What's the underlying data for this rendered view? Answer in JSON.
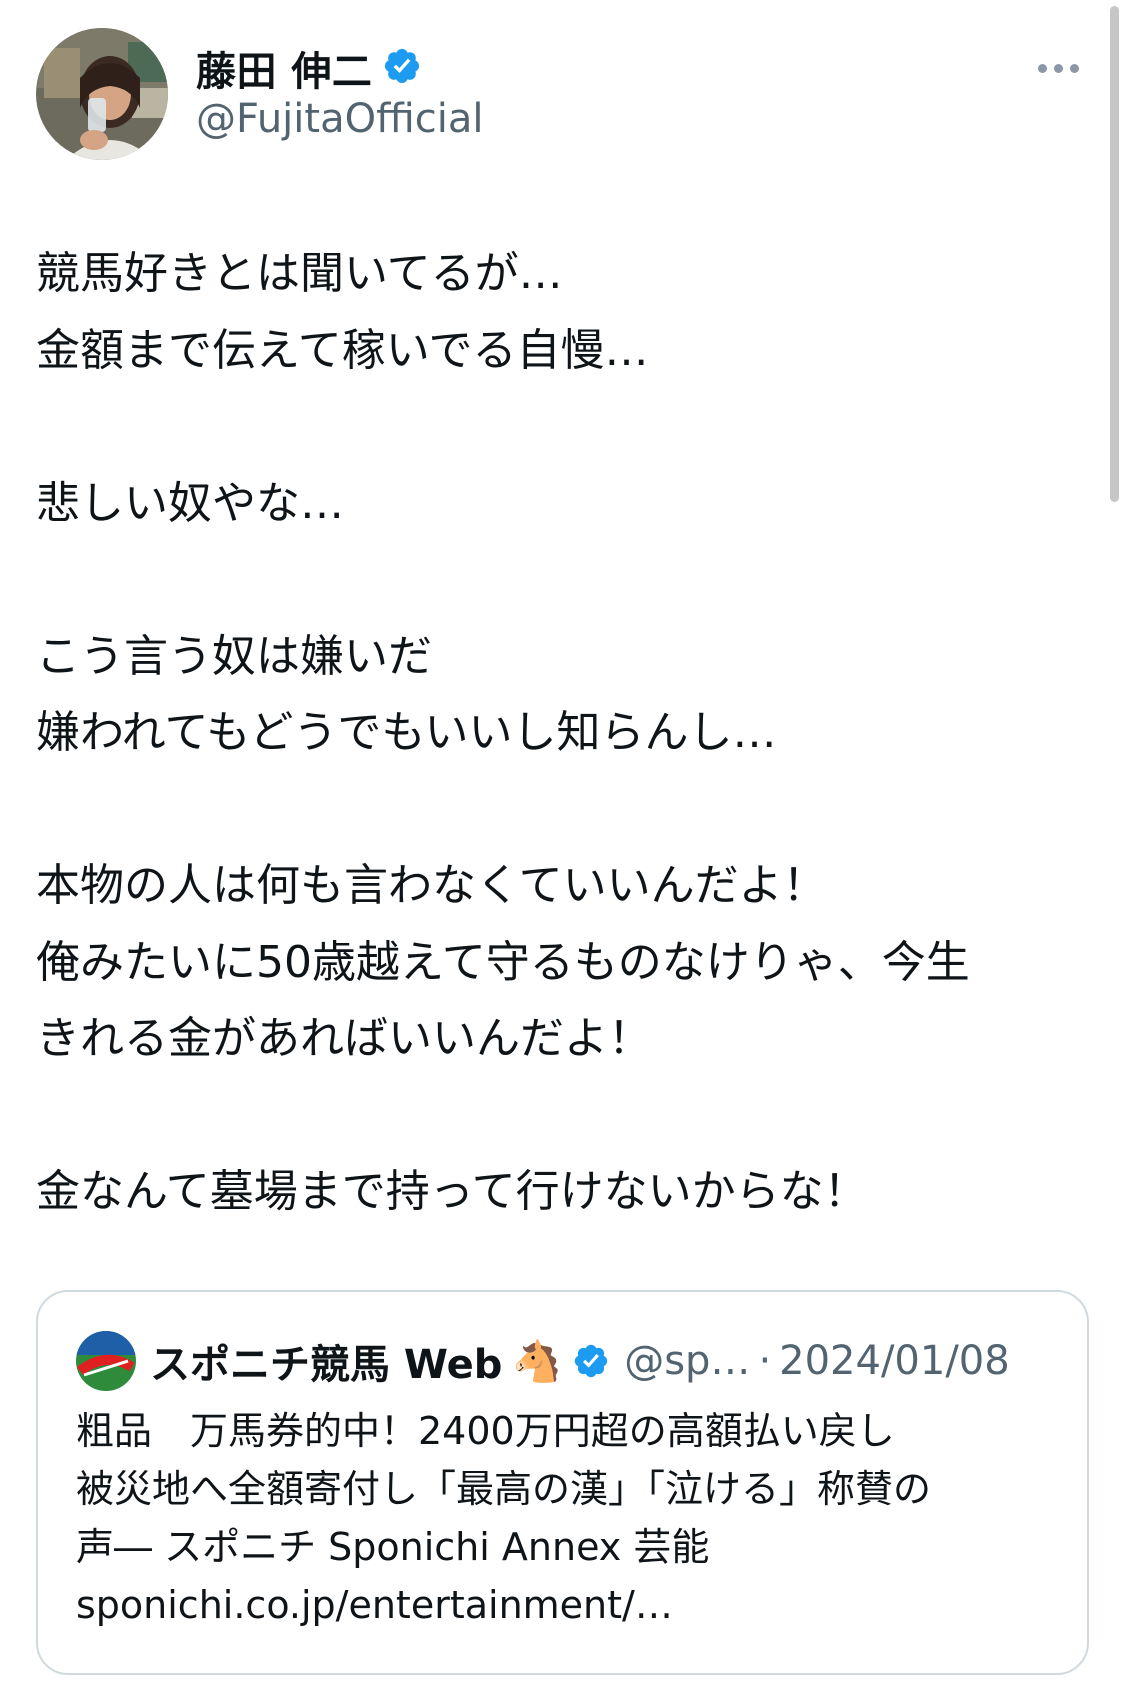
{
  "author": {
    "name": "藤田 伸二",
    "handle": "@FujitaOfficial",
    "verified": true,
    "badge_color": "#1d9bf0"
  },
  "tweet": {
    "text": "競馬好きとは聞いてるが…\n金額まで伝えて稼いでる自慢…\n\n悲しい奴やな…\n\nこう言う奴は嫌いだ\n嫌われてもどうでもいいし知らんし…\n\n本物の人は何も言わなくていいんだよ！\n俺みたいに50歳越えて守るものなけりゃ、今生\nきれる金があればいいんだよ！\n\n金なんて墓場まで持って行けないからな！"
  },
  "quoted": {
    "name": "スポニチ競馬 Web",
    "emoji": "🐴",
    "verified": true,
    "handle": "@sp…",
    "separator": "·",
    "date": "2024/01/08",
    "text": "粗品　万馬券的中！2400万円超の高額払い戻し\n被災地へ全額寄付し「最高の漢」「泣ける」称賛の\n声― スポニチ Sponichi Annex 芸能\nsponichi.co.jp/entertainment/…"
  },
  "icons": {
    "more": "more-horizontal-icon",
    "verified": "verified-badge-icon"
  }
}
